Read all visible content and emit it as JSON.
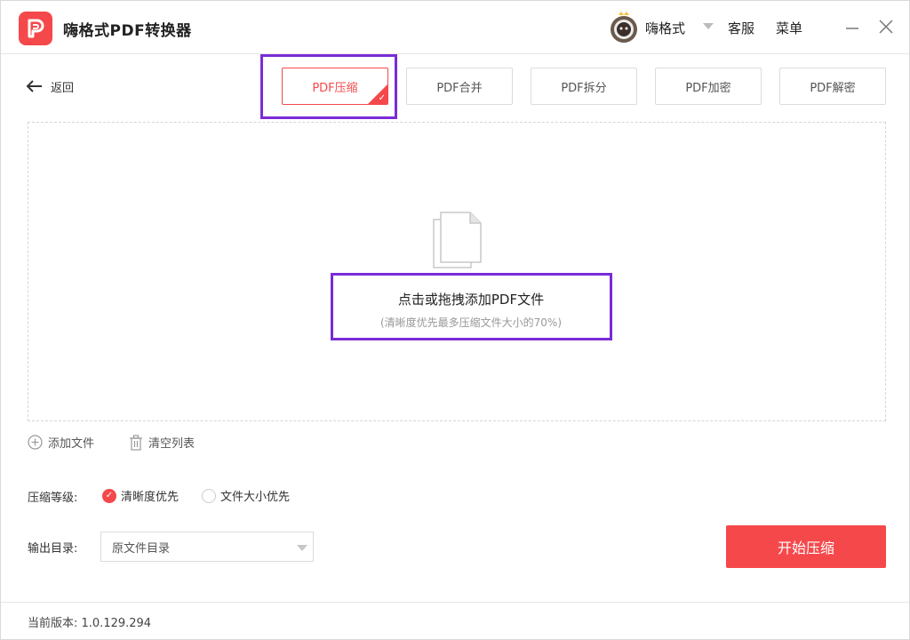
{
  "app": {
    "title": "嗨格式PDF转换器",
    "username": "嗨格式",
    "service_label": "客服",
    "menu_label": "菜单"
  },
  "nav": {
    "back_label": "返回"
  },
  "tabs": [
    {
      "label": "PDF压缩",
      "active": true
    },
    {
      "label": "PDF合并",
      "active": false
    },
    {
      "label": "PDF拆分",
      "active": false
    },
    {
      "label": "PDF加密",
      "active": false
    },
    {
      "label": "PDF解密",
      "active": false
    }
  ],
  "dropzone": {
    "title": "点击或拖拽添加PDF文件",
    "subtitle": "(清晰度优先最多压缩文件大小的70%)"
  },
  "file_actions": {
    "add_label": "添加文件",
    "clear_label": "清空列表"
  },
  "compression": {
    "label": "压缩等级:",
    "options": [
      {
        "label": "清晰度优先",
        "checked": true
      },
      {
        "label": "文件大小优先",
        "checked": false
      }
    ]
  },
  "output": {
    "label": "输出目录:",
    "selected": "原文件目录"
  },
  "start_button": "开始压缩",
  "footer": {
    "version": "当前版本:  1.0.129.294"
  },
  "colors": {
    "accent": "#f5484b",
    "highlight": "#7a2cd6"
  },
  "icons": {
    "logo": "app-logo-icon",
    "back": "arrow-left-icon",
    "doc": "document-icon",
    "add": "plus-circle-icon",
    "clear": "trash-icon",
    "minimize": "minimize-icon",
    "close": "close-icon"
  }
}
